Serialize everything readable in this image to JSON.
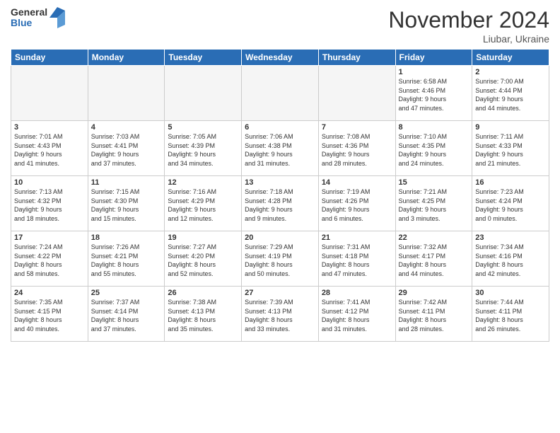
{
  "logo": {
    "line1": "General",
    "line2": "Blue"
  },
  "title": "November 2024",
  "location": "Liubar, Ukraine",
  "weekdays": [
    "Sunday",
    "Monday",
    "Tuesday",
    "Wednesday",
    "Thursday",
    "Friday",
    "Saturday"
  ],
  "days": [
    {
      "num": "",
      "info": ""
    },
    {
      "num": "",
      "info": ""
    },
    {
      "num": "",
      "info": ""
    },
    {
      "num": "",
      "info": ""
    },
    {
      "num": "",
      "info": ""
    },
    {
      "num": "1",
      "info": "Sunrise: 6:58 AM\nSunset: 4:46 PM\nDaylight: 9 hours\nand 47 minutes."
    },
    {
      "num": "2",
      "info": "Sunrise: 7:00 AM\nSunset: 4:44 PM\nDaylight: 9 hours\nand 44 minutes."
    },
    {
      "num": "3",
      "info": "Sunrise: 7:01 AM\nSunset: 4:43 PM\nDaylight: 9 hours\nand 41 minutes."
    },
    {
      "num": "4",
      "info": "Sunrise: 7:03 AM\nSunset: 4:41 PM\nDaylight: 9 hours\nand 37 minutes."
    },
    {
      "num": "5",
      "info": "Sunrise: 7:05 AM\nSunset: 4:39 PM\nDaylight: 9 hours\nand 34 minutes."
    },
    {
      "num": "6",
      "info": "Sunrise: 7:06 AM\nSunset: 4:38 PM\nDaylight: 9 hours\nand 31 minutes."
    },
    {
      "num": "7",
      "info": "Sunrise: 7:08 AM\nSunset: 4:36 PM\nDaylight: 9 hours\nand 28 minutes."
    },
    {
      "num": "8",
      "info": "Sunrise: 7:10 AM\nSunset: 4:35 PM\nDaylight: 9 hours\nand 24 minutes."
    },
    {
      "num": "9",
      "info": "Sunrise: 7:11 AM\nSunset: 4:33 PM\nDaylight: 9 hours\nand 21 minutes."
    },
    {
      "num": "10",
      "info": "Sunrise: 7:13 AM\nSunset: 4:32 PM\nDaylight: 9 hours\nand 18 minutes."
    },
    {
      "num": "11",
      "info": "Sunrise: 7:15 AM\nSunset: 4:30 PM\nDaylight: 9 hours\nand 15 minutes."
    },
    {
      "num": "12",
      "info": "Sunrise: 7:16 AM\nSunset: 4:29 PM\nDaylight: 9 hours\nand 12 minutes."
    },
    {
      "num": "13",
      "info": "Sunrise: 7:18 AM\nSunset: 4:28 PM\nDaylight: 9 hours\nand 9 minutes."
    },
    {
      "num": "14",
      "info": "Sunrise: 7:19 AM\nSunset: 4:26 PM\nDaylight: 9 hours\nand 6 minutes."
    },
    {
      "num": "15",
      "info": "Sunrise: 7:21 AM\nSunset: 4:25 PM\nDaylight: 9 hours\nand 3 minutes."
    },
    {
      "num": "16",
      "info": "Sunrise: 7:23 AM\nSunset: 4:24 PM\nDaylight: 9 hours\nand 0 minutes."
    },
    {
      "num": "17",
      "info": "Sunrise: 7:24 AM\nSunset: 4:22 PM\nDaylight: 8 hours\nand 58 minutes."
    },
    {
      "num": "18",
      "info": "Sunrise: 7:26 AM\nSunset: 4:21 PM\nDaylight: 8 hours\nand 55 minutes."
    },
    {
      "num": "19",
      "info": "Sunrise: 7:27 AM\nSunset: 4:20 PM\nDaylight: 8 hours\nand 52 minutes."
    },
    {
      "num": "20",
      "info": "Sunrise: 7:29 AM\nSunset: 4:19 PM\nDaylight: 8 hours\nand 50 minutes."
    },
    {
      "num": "21",
      "info": "Sunrise: 7:31 AM\nSunset: 4:18 PM\nDaylight: 8 hours\nand 47 minutes."
    },
    {
      "num": "22",
      "info": "Sunrise: 7:32 AM\nSunset: 4:17 PM\nDaylight: 8 hours\nand 44 minutes."
    },
    {
      "num": "23",
      "info": "Sunrise: 7:34 AM\nSunset: 4:16 PM\nDaylight: 8 hours\nand 42 minutes."
    },
    {
      "num": "24",
      "info": "Sunrise: 7:35 AM\nSunset: 4:15 PM\nDaylight: 8 hours\nand 40 minutes."
    },
    {
      "num": "25",
      "info": "Sunrise: 7:37 AM\nSunset: 4:14 PM\nDaylight: 8 hours\nand 37 minutes."
    },
    {
      "num": "26",
      "info": "Sunrise: 7:38 AM\nSunset: 4:13 PM\nDaylight: 8 hours\nand 35 minutes."
    },
    {
      "num": "27",
      "info": "Sunrise: 7:39 AM\nSunset: 4:13 PM\nDaylight: 8 hours\nand 33 minutes."
    },
    {
      "num": "28",
      "info": "Sunrise: 7:41 AM\nSunset: 4:12 PM\nDaylight: 8 hours\nand 31 minutes."
    },
    {
      "num": "29",
      "info": "Sunrise: 7:42 AM\nSunset: 4:11 PM\nDaylight: 8 hours\nand 28 minutes."
    },
    {
      "num": "30",
      "info": "Sunrise: 7:44 AM\nSunset: 4:11 PM\nDaylight: 8 hours\nand 26 minutes."
    }
  ]
}
